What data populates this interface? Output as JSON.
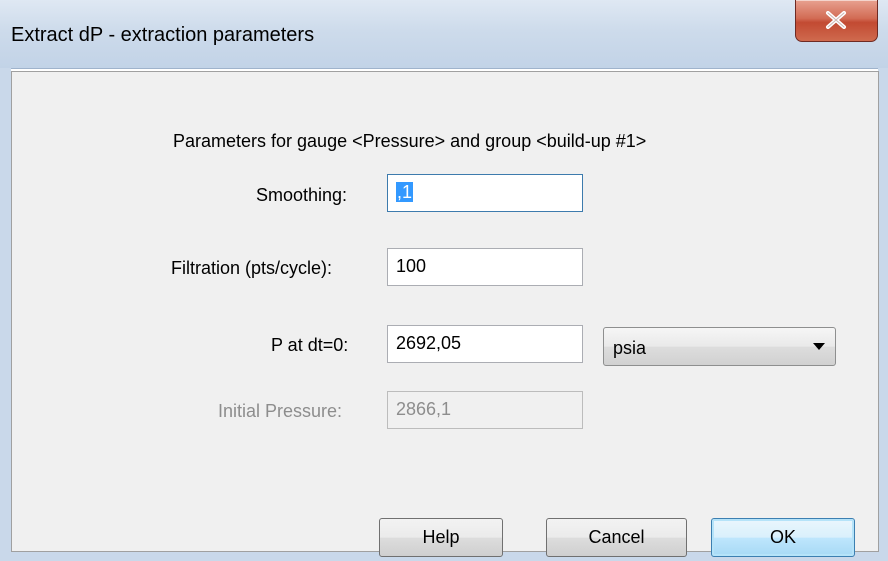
{
  "window": {
    "title": "Extract dP - extraction parameters"
  },
  "header": "Parameters for gauge <Pressure> and group <build-up #1>",
  "fields": {
    "smoothing": {
      "label": "Smoothing:",
      "value": ",1"
    },
    "filtration": {
      "label": "Filtration (pts/cycle):",
      "value": "100"
    },
    "p_at_dt0": {
      "label": "P at dt=0:",
      "value": "2692,05",
      "unit": "psia"
    },
    "initial_pressure": {
      "label": "Initial Pressure:",
      "value": "2866,1",
      "disabled": true
    }
  },
  "buttons": {
    "help": "Help",
    "cancel": "Cancel",
    "ok": "OK"
  },
  "colors": {
    "selection": "#3399ff",
    "close_button": "#c24a32",
    "default_button_border": "#3c7fb1"
  }
}
